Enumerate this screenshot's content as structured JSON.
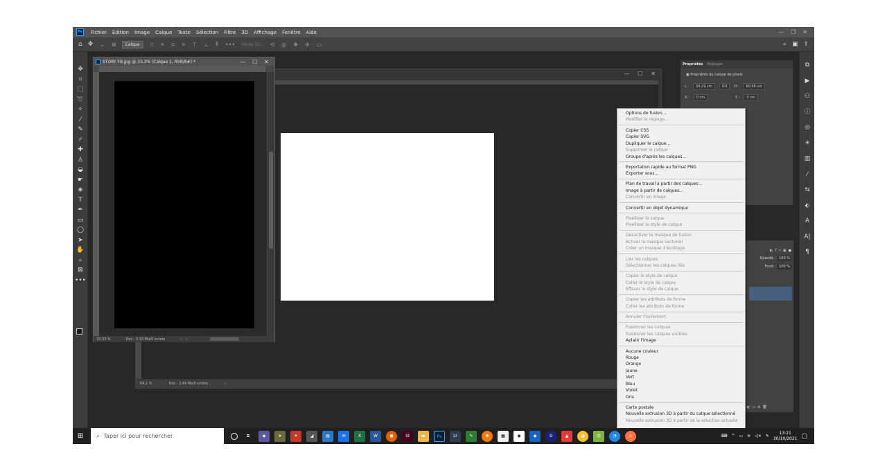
{
  "menubar": {
    "logo": "Ps",
    "items": [
      "Fichier",
      "Edition",
      "Image",
      "Calque",
      "Texte",
      "Sélection",
      "Filtre",
      "3D",
      "Affichage",
      "Fenêtre",
      "Aide"
    ]
  },
  "optionsbar": {
    "select_value": "Calque",
    "mode3d": "Mode 3D :"
  },
  "doc1": {
    "title": "STORY FB.jpg @ 33,3% (Calque 1, RVB/8#) *",
    "zoom": "33,33 %",
    "doc_size": "Doc : 5,93 Mo/0 octets"
  },
  "doc2": {
    "zoom": "64,1 %",
    "doc_size": "Doc : 2,49 Mo/0 octets"
  },
  "properties": {
    "tab_active": "Propriétés",
    "tab_other": "Réglages",
    "subtitle": "Propriétés du calque de pixels",
    "w_label": "L :",
    "w_value": "34,29 cm",
    "link": "GO",
    "h_label": "H :",
    "h_value": "60,96 cm",
    "x_label": "X :",
    "x_value": "0 cm",
    "y_label": "Y :",
    "y_value": "0 cm"
  },
  "layers": {
    "opacity_label": "Opacité :",
    "opacity_value": "100 %",
    "fill_label": "Fond :",
    "fill_value": "100 %"
  },
  "context_menu": {
    "groups": [
      [
        {
          "label": "Options de fusion...",
          "disabled": false
        },
        {
          "label": "Modifier le réglage...",
          "disabled": true
        }
      ],
      [
        {
          "label": "Copier CSS",
          "disabled": false
        },
        {
          "label": "Copier SVG",
          "disabled": false
        },
        {
          "label": "Dupliquer le calque...",
          "disabled": false
        },
        {
          "label": "Supprimer le calque",
          "disabled": true
        },
        {
          "label": "Groupe d'après les calques...",
          "disabled": false
        }
      ],
      [
        {
          "label": "Exportation rapide au format PNG",
          "disabled": false
        },
        {
          "label": "Exporter sous...",
          "disabled": false
        }
      ],
      [
        {
          "label": "Plan de travail à partir des calques...",
          "disabled": false
        },
        {
          "label": "Image à partir de calques...",
          "disabled": false
        },
        {
          "label": "Convertir en image",
          "disabled": true
        }
      ],
      [
        {
          "label": "Convertir en objet dynamique",
          "disabled": false
        }
      ],
      [
        {
          "label": "Pixelliser le calque",
          "disabled": true
        },
        {
          "label": "Pixelliser le style de calque",
          "disabled": true
        }
      ],
      [
        {
          "label": "Désactiver le masque de fusion",
          "disabled": true
        },
        {
          "label": "Activer le masque vectoriel",
          "disabled": true
        },
        {
          "label": "Créer un masque d'écrêtage",
          "disabled": true
        }
      ],
      [
        {
          "label": "Lier les calques",
          "disabled": true
        },
        {
          "label": "Sélectionner les calques liés",
          "disabled": true
        }
      ],
      [
        {
          "label": "Copier le style de calque",
          "disabled": true
        },
        {
          "label": "Coller le style de calque",
          "disabled": true
        },
        {
          "label": "Effacer le style de calque",
          "disabled": true
        }
      ],
      [
        {
          "label": "Copier les attributs de forme",
          "disabled": true
        },
        {
          "label": "Coller les attributs de forme",
          "disabled": true
        }
      ],
      [
        {
          "label": "Annuler l'isolement",
          "disabled": true
        }
      ],
      [
        {
          "label": "Fusionner les calques",
          "disabled": true
        },
        {
          "label": "Fusionner les calques visibles",
          "disabled": true
        },
        {
          "label": "Aplatir l'image",
          "disabled": false
        }
      ],
      [
        {
          "label": "Aucune couleur",
          "disabled": false
        },
        {
          "label": "Rouge",
          "disabled": false
        },
        {
          "label": "Orange",
          "disabled": false
        },
        {
          "label": "Jaune",
          "disabled": false
        },
        {
          "label": "Vert",
          "disabled": false
        },
        {
          "label": "Bleu",
          "disabled": false
        },
        {
          "label": "Violet",
          "disabled": false
        },
        {
          "label": "Gris",
          "disabled": false
        }
      ],
      [
        {
          "label": "Carte postale",
          "disabled": false
        },
        {
          "label": "Nouvelle extrusion 3D à partir du calque sélectionné",
          "disabled": false
        },
        {
          "label": "Nouvelle extrusion 3D à partir de la sélection actuelle",
          "disabled": true
        }
      ]
    ]
  },
  "taskbar": {
    "search_placeholder": "Taper ici pour rechercher",
    "time": "13:21",
    "date": "30/10/2021"
  }
}
